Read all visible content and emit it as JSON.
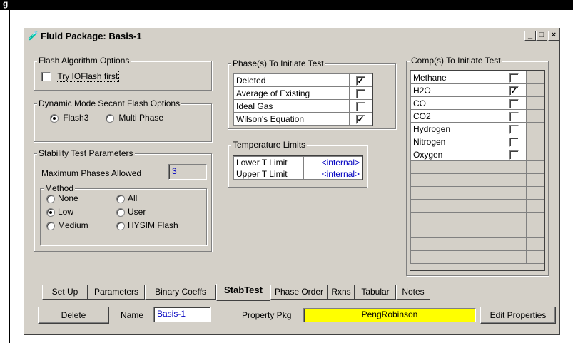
{
  "app": {
    "top_label": "g"
  },
  "window": {
    "title": "Fluid Package: Basis-1",
    "buttons": {
      "minimize": "_",
      "maximize": "□",
      "close": "×"
    }
  },
  "flash": {
    "legend": "Flash Algorithm Options",
    "try_ioflash": "Try IOFlash first",
    "try_ioflash_checked": false
  },
  "dynamic": {
    "legend": "Dynamic Mode Secant Flash Options",
    "options": [
      "Flash3",
      "Multi Phase"
    ],
    "selected": "Flash3"
  },
  "stability": {
    "legend": "Stability Test Parameters",
    "max_phases_label": "Maximum Phases Allowed",
    "max_phases_value": "3",
    "method_legend": "Method",
    "methods": [
      "None",
      "Low",
      "Medium",
      "All",
      "User",
      "HYSIM Flash"
    ],
    "selected": "Low"
  },
  "phases": {
    "legend": "Phase(s) To Initiate Test",
    "rows": [
      {
        "label": "Deleted",
        "checked": true
      },
      {
        "label": "Average of Existing",
        "checked": false
      },
      {
        "label": "Ideal Gas",
        "checked": false
      },
      {
        "label": "Wilson's Equation",
        "checked": true
      }
    ]
  },
  "temp": {
    "legend": "Temperature Limits",
    "rows": [
      {
        "label": "Lower T Limit",
        "value": "<internal>"
      },
      {
        "label": "Upper T Limit",
        "value": "<internal>"
      }
    ]
  },
  "comps": {
    "legend": "Comp(s) To Initiate Test",
    "rows": [
      {
        "label": "Methane",
        "checked": false
      },
      {
        "label": "H2O",
        "checked": true
      },
      {
        "label": "CO",
        "checked": false
      },
      {
        "label": "CO2",
        "checked": false
      },
      {
        "label": "Hydrogen",
        "checked": false
      },
      {
        "label": "Nitrogen",
        "checked": false
      },
      {
        "label": "Oxygen",
        "checked": false
      }
    ]
  },
  "tabs": [
    "Set Up",
    "Parameters",
    "Binary Coeffs",
    "StabTest",
    "Phase Order",
    "Rxns",
    "Tabular",
    "Notes"
  ],
  "active_tab": "StabTest",
  "footer": {
    "delete": "Delete",
    "name_label": "Name",
    "name_value": "Basis-1",
    "property_label": "Property Pkg",
    "property_value": "PengRobinson",
    "edit": "Edit Properties"
  },
  "colors": {
    "property_bg": "#ffff00",
    "value_text": "#0000c0"
  }
}
